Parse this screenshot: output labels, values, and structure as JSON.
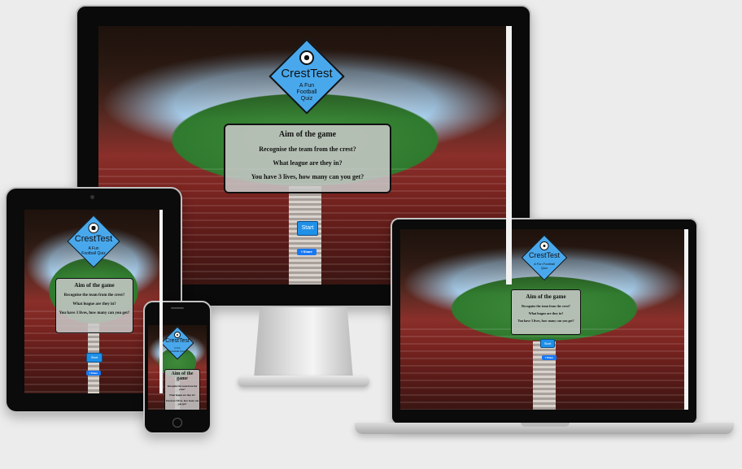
{
  "logo": {
    "title": "CrestTest",
    "subtitle": "A Fun Football Quiz",
    "icon": "football-icon"
  },
  "instructions": {
    "heading": "Aim of the game",
    "line1": "Recognise the team from the crest?",
    "line2": "What league are they in?",
    "line3": "You have 3 lives, how many can you get?"
  },
  "buttons": {
    "start": "Start",
    "share": "f Share"
  },
  "colors": {
    "accent": "#49a8ec",
    "start_button": "#1e90e8",
    "share_button": "#1877f2"
  }
}
